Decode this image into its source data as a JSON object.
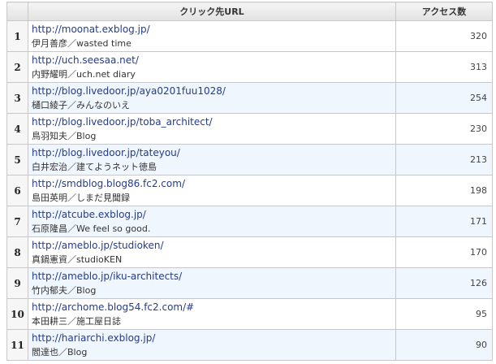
{
  "table": {
    "headers": {
      "rank": "",
      "url": "クリック先URL",
      "count": "アクセス数"
    },
    "rows": [
      {
        "rank": "1",
        "url": "http://moonat.exblog.jp/",
        "title": "伊月善彦／wasted time",
        "count": "320"
      },
      {
        "rank": "2",
        "url": "http://uch.seesaa.net/",
        "title": "内野耀明／uch.net diary",
        "count": "313"
      },
      {
        "rank": "3",
        "url": "http://blog.livedoor.jp/aya0201fuu1028/",
        "title": "樋口綾子／みんなのいえ",
        "count": "254"
      },
      {
        "rank": "4",
        "url": "http://blog.livedoor.jp/toba_architect/",
        "title": "鳥羽知夫／Blog",
        "count": "230"
      },
      {
        "rank": "5",
        "url": "http://blog.livedoor.jp/tateyou/",
        "title": "白井宏治／建てようネット徳島",
        "count": "213"
      },
      {
        "rank": "6",
        "url": "http://smdblog.blog86.fc2.com/",
        "title": "島田英明／しまだ見聞録",
        "count": "198"
      },
      {
        "rank": "7",
        "url": "http://atcube.exblog.jp/",
        "title": "石原隆昌／We feel so good.",
        "count": "171"
      },
      {
        "rank": "8",
        "url": "http://ameblo.jp/studioken/",
        "title": "真鍋憲資／studioKEN",
        "count": "170"
      },
      {
        "rank": "9",
        "url": "http://ameblo.jp/iku-architects/",
        "title": "竹内郁夫／Blog",
        "count": "126"
      },
      {
        "rank": "10",
        "url": "http://archome.blog54.fc2.com/#",
        "title": "本田耕三／施工屋日誌",
        "count": "95"
      },
      {
        "rank": "11",
        "url": "http://hariarchi.exblog.jp/",
        "title": "閻達也／Blog",
        "count": "90"
      }
    ]
  }
}
